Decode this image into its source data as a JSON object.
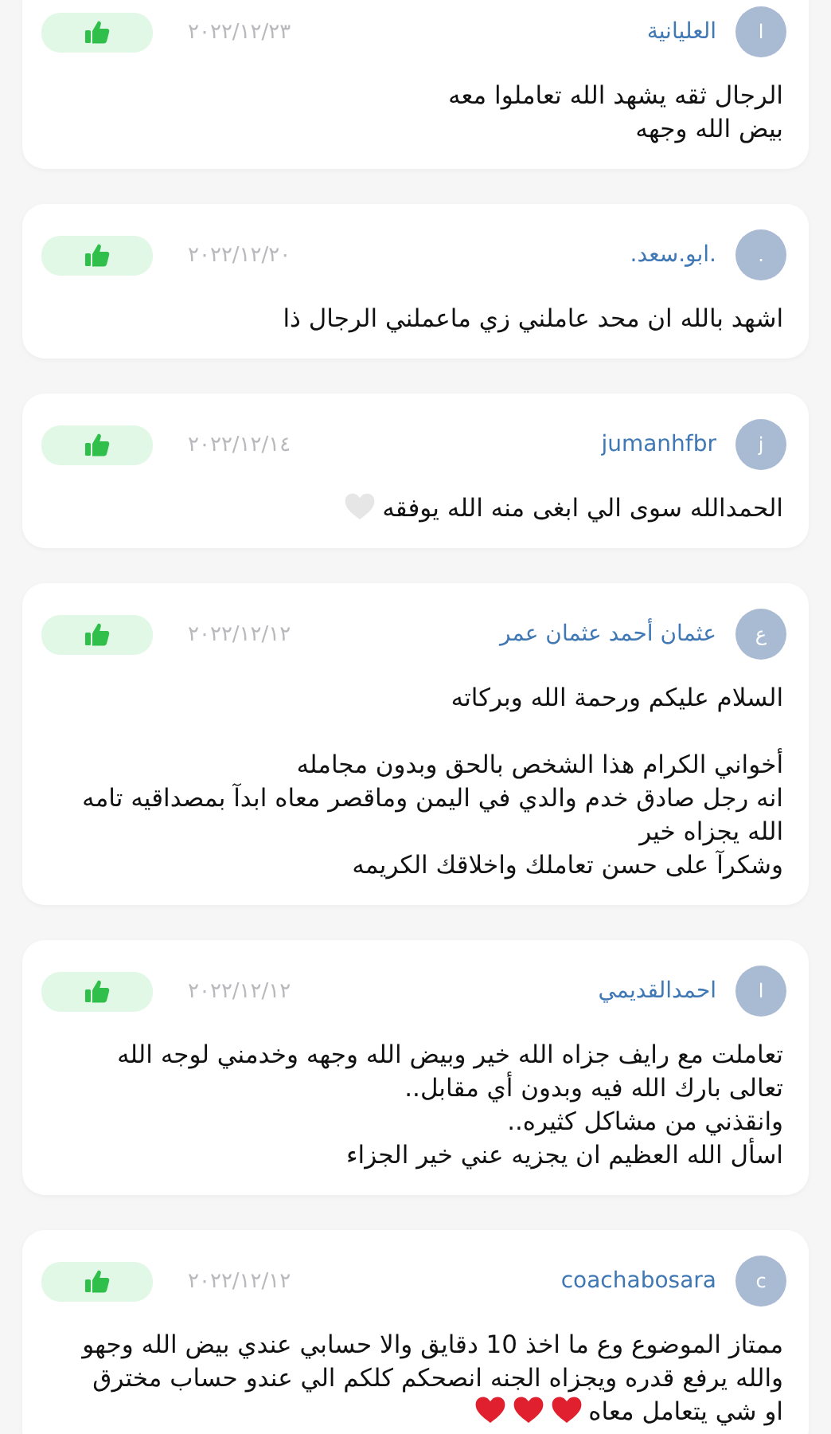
{
  "comments": [
    {
      "avatar": "ا",
      "author": "العليانية",
      "date": "٢٠٢٢/١٢/٢٣",
      "liked": true,
      "body": "الرجال ثقه يشهد الله تعاملوا معه\n بيض الله وجهه"
    },
    {
      "avatar": ".",
      "author": ".ابو.سعد.",
      "date": "٢٠٢٢/١٢/٢٠",
      "liked": true,
      "body": "اشهد بالله ان محد عاملني زي ماعملني الرجال ذا"
    },
    {
      "avatar": "j",
      "author": "jumanhfbr",
      "date": "٢٠٢٢/١٢/١٤",
      "liked": true,
      "body": "الحمدالله سوى الي ابغى منه الله يوفقه",
      "hearts": [
        {
          "color": "#e6e6e6"
        }
      ]
    },
    {
      "avatar": "ع",
      "author": "عثمان أحمد عثمان عمر",
      "date": "٢٠٢٢/١٢/١٢",
      "liked": true,
      "body": "السلام عليكم ورحمة الله وبركاته\n\nأخواني الكرام هذا الشخص بالحق وبدون مجامله\nانه رجل صادق خدم والدي في اليمن وماقصر معاه ابدآ بمصداقيه تامه\nالله يجزاه خير\nوشكرآ على حسن تعاملك واخلاقك الكريمه"
    },
    {
      "avatar": "ا",
      "author": "احمدالقديمي",
      "date": "٢٠٢٢/١٢/١٢",
      "liked": true,
      "body": "تعاملت مع رايف جزاه الله خير وبيض الله وجهه وخدمني لوجه الله\nتعالى بارك الله فيه وبدون أي مقابل..\nوانقذني من مشاكل كثيره..\nاسأل الله العظيم ان يجزيه عني خير الجزاء"
    },
    {
      "avatar": "c",
      "author": "coachabosara",
      "date": "٢٠٢٢/١٢/١٢",
      "liked": true,
      "body": "ممتاز الموضوع وع ما اخذ 10 دقايق والا حسابي عندي بيض الله وجهو\nوالله يرفع قدره ويجزاه الجنه انصحكم كلكم الي عندو حساب مخترق\nاو شي يتعامل معاه",
      "hearts": [
        {
          "color": "#e0202e"
        },
        {
          "color": "#e0202e"
        },
        {
          "color": "#e0202e"
        }
      ]
    }
  ]
}
